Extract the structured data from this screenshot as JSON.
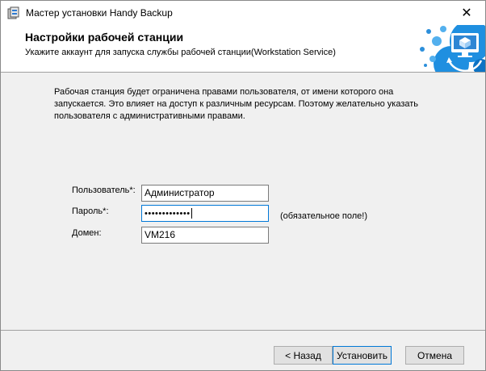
{
  "window": {
    "title": "Мастер установки Handy Backup"
  },
  "header": {
    "title": "Настройки рабочей станции",
    "subtitle": "Укажите аккаунт для запуска службы рабочей станции(Workstation Service)"
  },
  "body": {
    "description": "Рабочая станция будет ограничена правами пользователя, от имени которого она запускается. Это влияет на доступ к различным ресурсам. Поэтому желательно указать пользователя с административными правами."
  },
  "form": {
    "user_label": "Пользователь*:",
    "user_value": "Администратор",
    "password_label": "Пароль*:",
    "password_value": "•••••••••••••",
    "domain_label": "Домен:",
    "domain_value": "VM216",
    "required_note": "(обязательное поле!)"
  },
  "buttons": {
    "back": "< Назад",
    "install": "Установить",
    "cancel": "Отмена"
  },
  "colors": {
    "accent": "#0078d7",
    "header_art_blue": "#1e8fd8"
  },
  "icons": {
    "app": "installer-icon",
    "close": "close-icon",
    "header": "workstation-monitor-icon"
  }
}
